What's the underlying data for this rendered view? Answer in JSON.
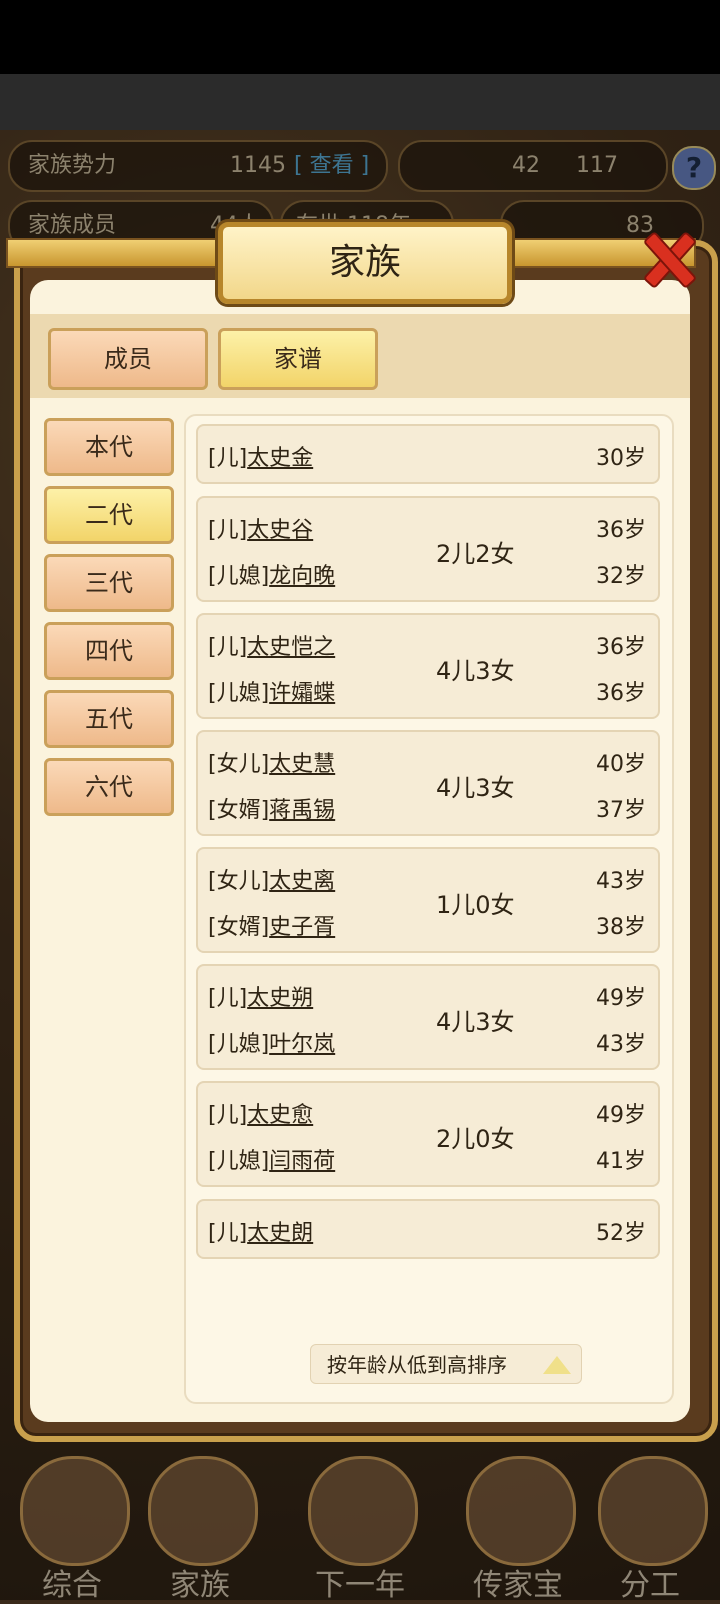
{
  "hud": {
    "power_label": "家族势力",
    "power_value": "1145",
    "power_tag": "[ 查看 ]",
    "resource_a": "42",
    "resource_b": "117",
    "members_label": "家族成员",
    "members_value": "44人",
    "year_text": "在世 118年",
    "gold": "83"
  },
  "dialog": {
    "title": "家族",
    "tabs": [
      {
        "label": "成员"
      },
      {
        "label": "家谱"
      }
    ],
    "active_tab": "家谱",
    "generations": [
      {
        "label": "本代"
      },
      {
        "label": "二代"
      },
      {
        "label": "三代"
      },
      {
        "label": "四代"
      },
      {
        "label": "五代"
      },
      {
        "label": "六代"
      }
    ],
    "active_generation": "二代",
    "entries": [
      {
        "role1": "[儿]",
        "name1": "太史金",
        "age1": "30岁"
      },
      {
        "role1": "[儿]",
        "name1": "太史谷",
        "age1": "36岁",
        "role2": "[儿媳]",
        "name2": "龙向晚",
        "age2": "32岁",
        "children": "2儿2女"
      },
      {
        "role1": "[儿]",
        "name1": "太史恺之",
        "age1": "36岁",
        "role2": "[儿媳]",
        "name2": "许孀蝶",
        "age2": "36岁",
        "children": "4儿3女"
      },
      {
        "role1": "[女儿]",
        "name1": "太史慧",
        "age1": "40岁",
        "role2": "[女婿]",
        "name2": "蒋禹锡",
        "age2": "37岁",
        "children": "4儿3女"
      },
      {
        "role1": "[女儿]",
        "name1": "太史离",
        "age1": "43岁",
        "role2": "[女婿]",
        "name2": "史子胥",
        "age2": "38岁",
        "children": "1儿0女"
      },
      {
        "role1": "[儿]",
        "name1": "太史朔",
        "age1": "49岁",
        "role2": "[儿媳]",
        "name2": "叶尔岚",
        "age2": "43岁",
        "children": "4儿3女"
      },
      {
        "role1": "[儿]",
        "name1": "太史愈",
        "age1": "49岁",
        "role2": "[儿媳]",
        "name2": "闫雨荷",
        "age2": "41岁",
        "children": "2儿0女"
      },
      {
        "role1": "[儿]",
        "name1": "太史朗",
        "age1": "52岁"
      }
    ],
    "sort_label": "按年龄从低到高排序"
  },
  "bottom_nav": [
    {
      "label": "综合"
    },
    {
      "label": "家族"
    },
    {
      "label": "下一年"
    },
    {
      "label": "传家宝"
    },
    {
      "label": "分工"
    }
  ],
  "colors": {
    "accent_gold": "#c9a04c",
    "tab_active": "#f2d469",
    "close_red": "#d9301f"
  }
}
